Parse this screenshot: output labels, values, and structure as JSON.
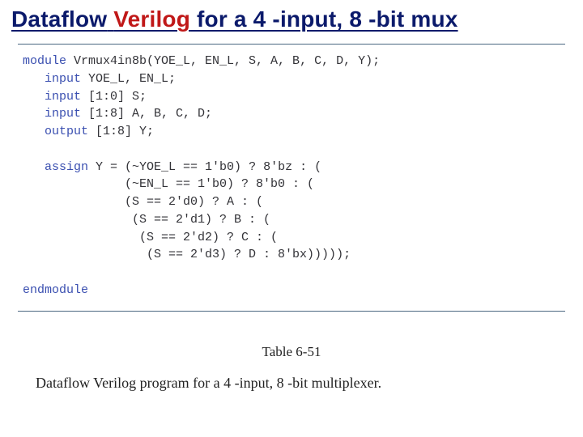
{
  "title": {
    "word1": "Dataflow",
    "word2": "Verilog",
    "rest": " for a 4 -input, 8 -bit mux"
  },
  "code": {
    "kw_module": "module",
    "module_decl": " Vrmux4in8b(YOE_L, EN_L, S, A, B, C, D, Y);",
    "kw_input1": "input",
    "input1": " YOE_L, EN_L;",
    "kw_input2": "input",
    "input2": " [1:0] S;",
    "kw_input3": "input",
    "input3": " [1:8] A, B, C, D;",
    "kw_output": "output",
    "output1": " [1:8] Y;",
    "kw_assign": "assign",
    "assign_l1": " Y = (~YOE_L == 1'b0) ? 8'bz : (",
    "assign_l2": "              (~EN_L == 1'b0) ? 8'b0 : (",
    "assign_l3": "              (S == 2'd0) ? A : (",
    "assign_l4": "               (S == 2'd1) ? B : (",
    "assign_l5": "                (S == 2'd2) ? C : (",
    "assign_l6": "                 (S == 2'd3) ? D : 8'bx)))));",
    "kw_endmodule": "endmodule"
  },
  "table_label": "Table 6-51",
  "caption": "Dataflow Verilog program for a 4 -input, 8 -bit multiplexer."
}
